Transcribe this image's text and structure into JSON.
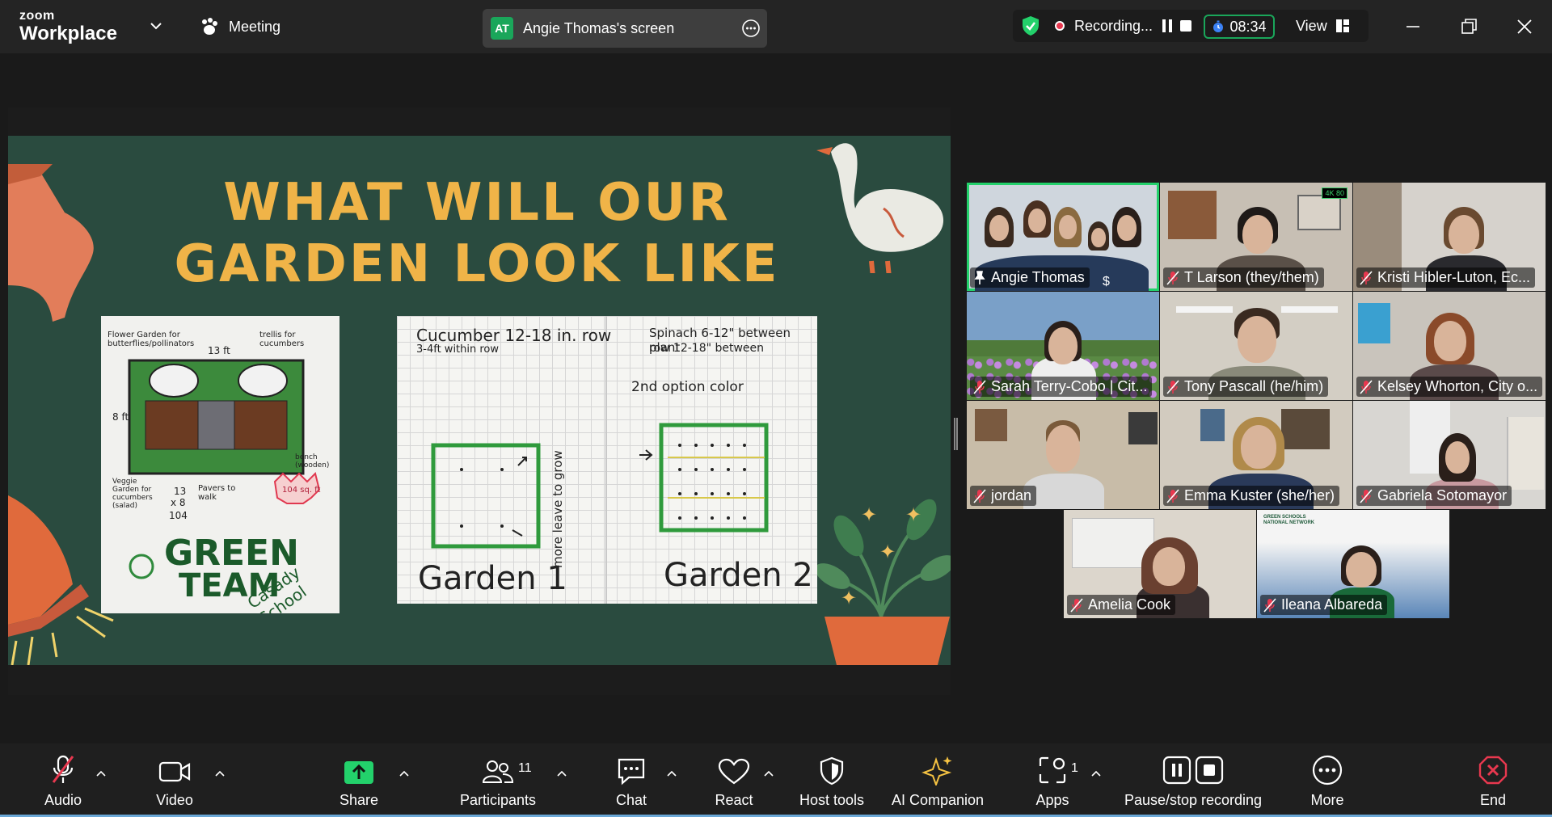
{
  "app": {
    "logo_line1": "zoom",
    "logo_line2": "Workplace",
    "meeting_label": "Meeting",
    "share_indicator": {
      "avatar_initials": "AT",
      "label": "Angie Thomas's screen"
    },
    "recording": {
      "label": "Recording...",
      "timer": "08:34"
    },
    "view_label": "View"
  },
  "slide": {
    "title_line1": "WHAT WILL OUR",
    "title_line2": "GARDEN LOOK LIKE",
    "drawing1": {
      "notes": [
        "Flower Garden for butterflies/pollinators",
        "13 ft",
        "trellis for cucumbers",
        "8 ft",
        "Veggie Garden for cucumbers (salad)",
        "13",
        "x 8",
        "104",
        "Pavers to walk",
        "104 sq. ft",
        "bench (wooden)"
      ],
      "caption_line1": "GREEN",
      "caption_line2": "TEAM",
      "school": "Casady School"
    },
    "drawing2": {
      "left_note_line1": "Cucumber 12-18 in. row",
      "left_note_line2": "3-4ft within row",
      "right_note_line1": "Spinach 6-12\" between plant",
      "right_note_line2": "row 12-18\" between",
      "right_note_line3": "2nd option color",
      "side_note": "more leave to grow",
      "garden1": "Garden 1",
      "garden2": "Garden 2"
    }
  },
  "participants": [
    {
      "name": "Angie Thomas",
      "pinned": true,
      "muted": false,
      "active": true
    },
    {
      "name": "T Larson (they/them)",
      "muted": true
    },
    {
      "name": "Kristi Hibler-Luton, Ec...",
      "muted": true
    },
    {
      "name": "Sarah Terry-Cobo | Cit...",
      "muted": true
    },
    {
      "name": "Tony Pascall (he/him)",
      "muted": true
    },
    {
      "name": "Kelsey Whorton, City o...",
      "muted": true
    },
    {
      "name": "jordan",
      "muted": true
    },
    {
      "name": "Emma Kuster (she/her)",
      "muted": true
    },
    {
      "name": "Gabriela Sotomayor",
      "muted": true
    },
    {
      "name": "Amelia Cook",
      "muted": true
    },
    {
      "name": "Ileana Albareda",
      "muted": true
    }
  ],
  "tile_extras": {
    "tlarson_corner_badge": "4K 80",
    "ileana_logo": "GREEN SCHOOLS NATIONAL NETWORK"
  },
  "toolbar": {
    "audio": "Audio",
    "video": "Video",
    "share": "Share",
    "participants": "Participants",
    "participants_count": "11",
    "chat": "Chat",
    "react": "React",
    "host_tools": "Host tools",
    "ai_companion": "AI Companion",
    "apps": "Apps",
    "apps_count": "1",
    "pause_stop": "Pause/stop recording",
    "more": "More",
    "end": "End"
  },
  "colors": {
    "accent_green": "#23d16b",
    "share_green": "#1aa65a",
    "end_red": "#e8384f",
    "slide_bg": "#2a4b3f",
    "title_gold": "#f0b448"
  }
}
